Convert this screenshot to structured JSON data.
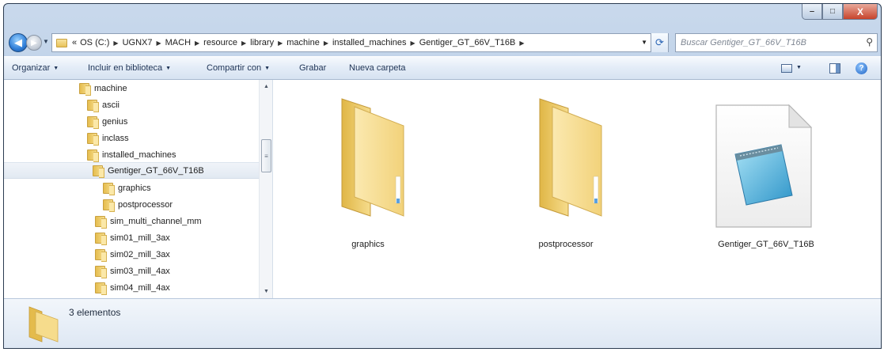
{
  "window": {
    "minimize_label": "‒",
    "maximize_label": "□",
    "close_label": "X"
  },
  "nav": {
    "back_symbol": "◀",
    "forward_symbol": "▶",
    "breadcrumb_prefix": "«",
    "breadcrumbs": [
      "OS (C:)",
      "UGNX7",
      "MACH",
      "resource",
      "library",
      "machine",
      "installed_machines",
      "Gentiger_GT_66V_T16B"
    ],
    "refresh_symbol": "⟳"
  },
  "search": {
    "placeholder": "Buscar Gentiger_GT_66V_T16B"
  },
  "toolbar": {
    "organize": "Organizar",
    "include_library": "Incluir en biblioteca",
    "share_with": "Compartir con",
    "burn": "Grabar",
    "new_folder": "Nueva carpeta",
    "help_symbol": "?"
  },
  "tree": {
    "items": [
      {
        "label": "machine"
      },
      {
        "label": "ascii"
      },
      {
        "label": "genius"
      },
      {
        "label": "inclass"
      },
      {
        "label": "installed_machines"
      },
      {
        "label": "Gentiger_GT_66V_T16B",
        "selected": true
      },
      {
        "label": "graphics"
      },
      {
        "label": "postprocessor"
      },
      {
        "label": "sim_multi_channel_mm"
      },
      {
        "label": "sim01_mill_3ax"
      },
      {
        "label": "sim02_mill_3ax"
      },
      {
        "label": "sim03_mill_4ax"
      },
      {
        "label": "sim04_mill_4ax"
      }
    ]
  },
  "files": {
    "items": [
      {
        "name": "graphics",
        "type": "folder"
      },
      {
        "name": "postprocessor",
        "type": "folder"
      },
      {
        "name": "Gentiger_GT_66V_T16B",
        "type": "document"
      }
    ]
  },
  "status": {
    "count_text": "3 elementos"
  },
  "colors": {
    "folder_yellow": "#f1d67c",
    "accent_blue": "#2f7ed8"
  }
}
